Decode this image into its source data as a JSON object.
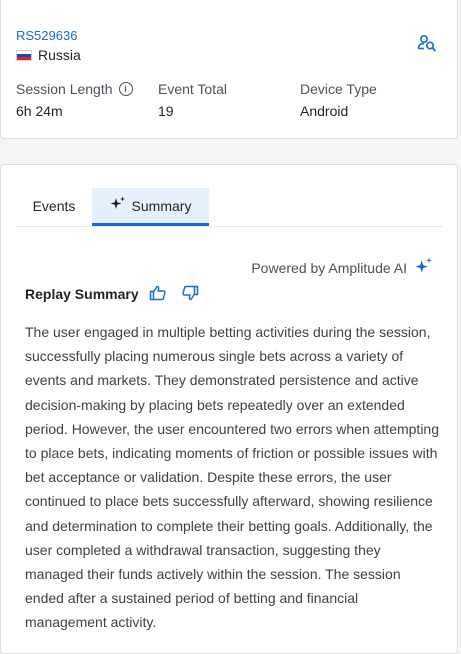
{
  "header": {
    "user_id": "RS529636",
    "country": "Russia",
    "country_flag": "russia-flag-icon",
    "search_icon": "user-search-icon"
  },
  "stats": {
    "session_length_label": "Session Length",
    "session_length_value": "6h 24m",
    "event_total_label": "Event Total",
    "event_total_value": "19",
    "device_type_label": "Device Type",
    "device_type_value": "Android"
  },
  "tabs": {
    "events_label": "Events",
    "summary_label": "Summary",
    "active": "Summary"
  },
  "summary": {
    "powered_by": "Powered by Amplitude AI",
    "title": "Replay Summary",
    "text": "The user engaged in multiple betting activities during the session, successfully placing numerous single bets across a variety of events and markets. They demonstrated persistence and active decision-making by placing bets repeatedly over an extended period. However, the user encountered two errors when attempting to place bets, indicating moments of friction or possible issues with bet acceptance or validation. Despite these errors, the user continued to place bets successfully afterward, showing resilience and determination to complete their betting goals. Additionally, the user completed a withdrawal transaction, suggesting they managed their funds actively within the session. The session ended after a sustained period of betting and financial management activity."
  },
  "colors": {
    "accent": "#1a6ad6",
    "tab_active_bg": "#e6f1fd"
  }
}
